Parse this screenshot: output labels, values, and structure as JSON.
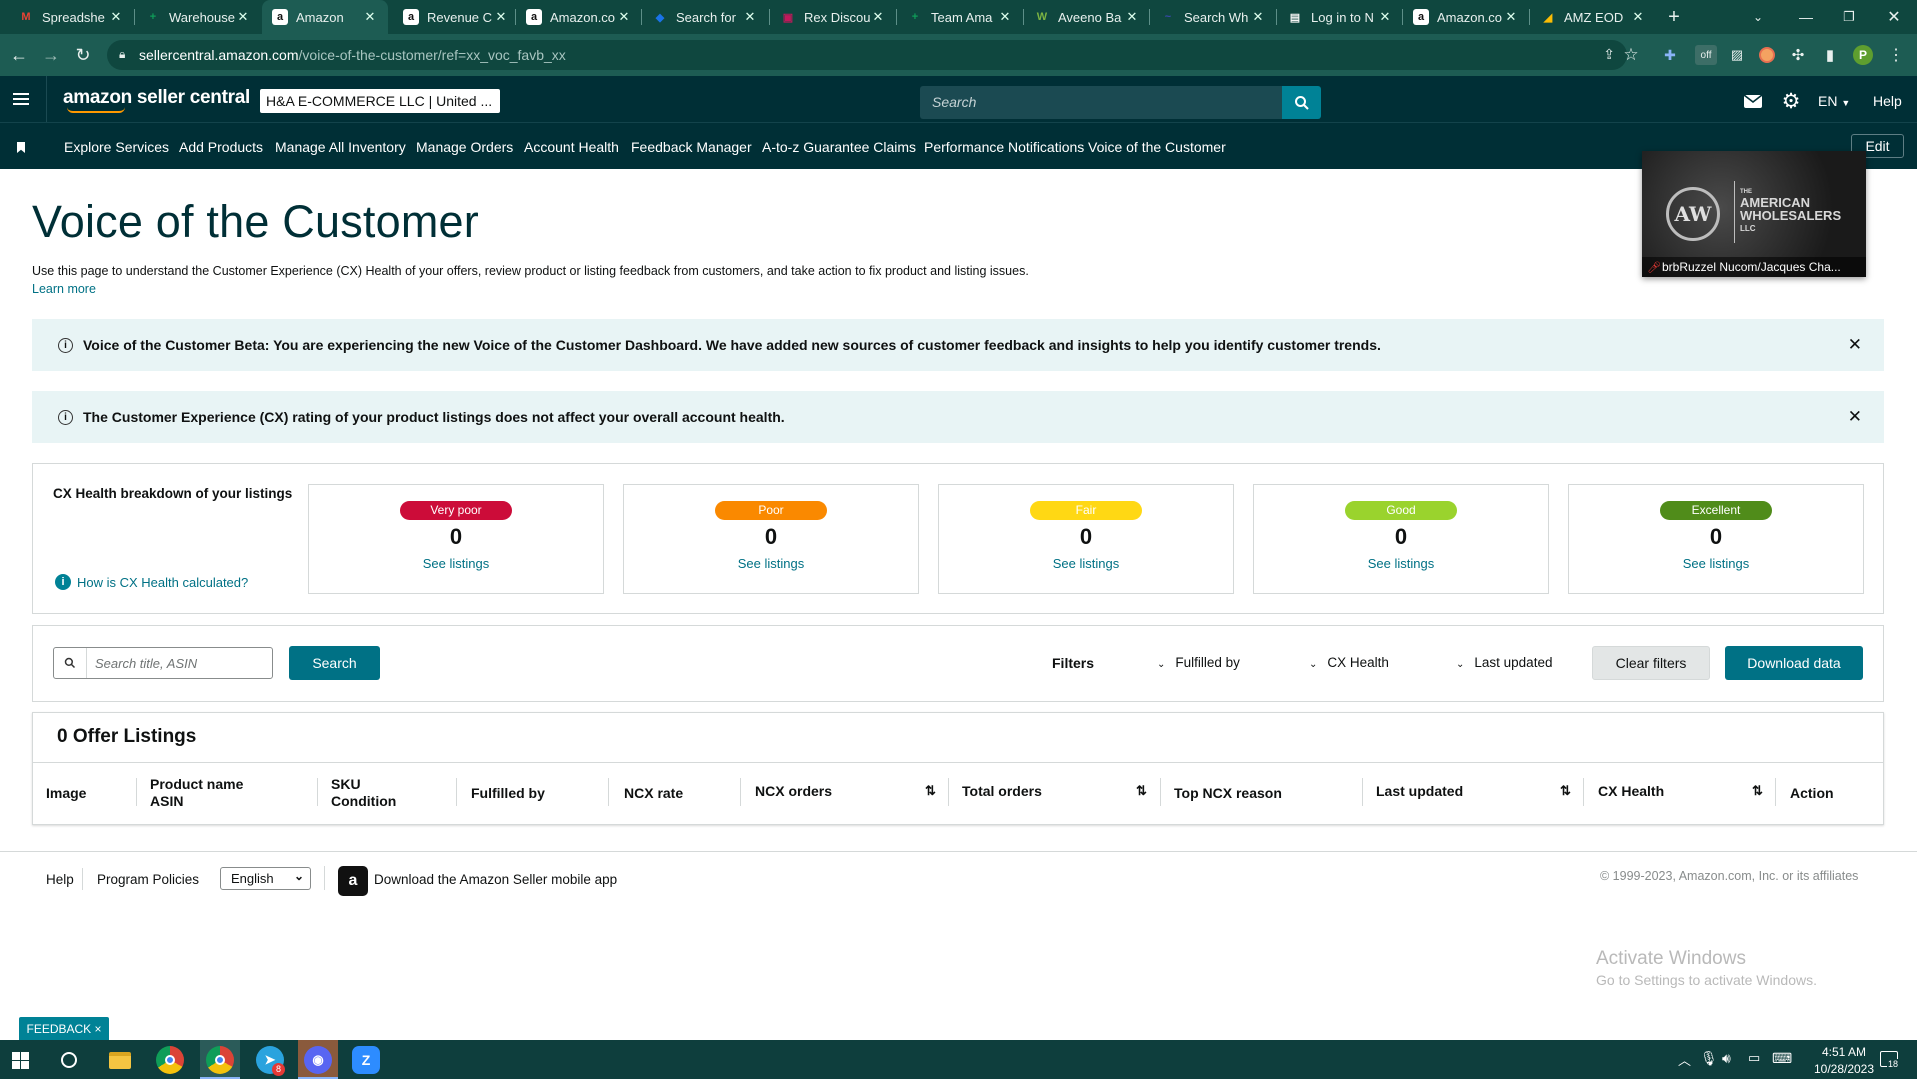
{
  "browser": {
    "tabs": [
      {
        "title": "Spreadshe",
        "fav": "M",
        "fav_color": "#ea4335"
      },
      {
        "title": "Warehouse",
        "fav": "+",
        "fav_color": "#0f9d58"
      },
      {
        "title": "Amazon",
        "fav": "a",
        "fav_color": "#111111"
      },
      {
        "title": "Revenue C",
        "fav": "a",
        "fav_color": "#111111"
      },
      {
        "title": "Amazon.co",
        "fav": "a",
        "fav_color": "#111111"
      },
      {
        "title": "Search for",
        "fav": "◆",
        "fav_color": "#1a73e8"
      },
      {
        "title": "Rex Discou",
        "fav": "▣",
        "fav_color": "#c2185b"
      },
      {
        "title": "Team Ama",
        "fav": "+",
        "fav_color": "#0f9d58"
      },
      {
        "title": "Aveeno Ba",
        "fav": "W",
        "fav_color": "#7cb342"
      },
      {
        "title": "Search Wh",
        "fav": "~",
        "fav_color": "#3949ab"
      },
      {
        "title": "Log in to N",
        "fav": "▤",
        "fav_color": "#f5f5f5"
      },
      {
        "title": "Amazon.co",
        "fav": "a",
        "fav_color": "#111111"
      },
      {
        "title": "AMZ EOD",
        "fav": "◢",
        "fav_color": "#fbbc04"
      }
    ],
    "url_host": "sellercentral.amazon.com",
    "url_path": "/voice-of-the-customer/ref=xx_voc_favb_xx",
    "profile_initial": "P"
  },
  "header": {
    "logo_text": "amazon seller central",
    "account_selector": "H&A E-COMMERCE LLC | United ...",
    "search_placeholder": "Search",
    "language": "EN",
    "help": "Help"
  },
  "nav": {
    "items": [
      "Explore Services",
      "Add Products",
      "Manage All Inventory",
      "Manage Orders",
      "Account Health",
      "Feedback Manager",
      "A-to-z Guarantee Claims",
      "Performance Notifications",
      "Voice of the Customer"
    ],
    "edit": "Edit"
  },
  "video_overlay": {
    "brand_line1": "THE",
    "brand_line2": "AMERICAN",
    "brand_line3": "WHOLESALERS",
    "brand_line4": "LLC",
    "caption": "brbRuzzel Nucom/Jacques Cha..."
  },
  "page": {
    "title": "Voice of the Customer",
    "description": "Use this page to understand the Customer Experience (CX) Health of your offers, review product or listing feedback from customers, and take action to fix product and listing issues.",
    "learn_more": "Learn more",
    "banner1": "Voice of the Customer Beta: You are experiencing the new Voice of the Customer Dashboard. We have added new sources of customer feedback and insights to help you identify customer trends.",
    "banner2": "The Customer Experience (CX) rating of your product listings does not affect your overall account health.",
    "breakdown_title": "CX Health breakdown of your listings",
    "how_calculated": "How is CX Health calculated?",
    "health_cards": [
      {
        "label": "Very poor",
        "count": "0",
        "link": "See listings",
        "color": "#cc0c39",
        "text_color": "#ffffff"
      },
      {
        "label": "Poor",
        "count": "0",
        "link": "See listings",
        "color": "#fa8900",
        "text_color": "#ffffff"
      },
      {
        "label": "Fair",
        "count": "0",
        "link": "See listings",
        "color": "#ffd814",
        "text_color": "#ffffff"
      },
      {
        "label": "Good",
        "count": "0",
        "link": "See listings",
        "color": "#9ad32d",
        "text_color": "#ffffff"
      },
      {
        "label": "Excellent",
        "count": "0",
        "link": "See listings",
        "color": "#508c1a",
        "text_color": "#ffffff"
      }
    ],
    "search_placeholder": "Search title, ASIN",
    "search_button": "Search",
    "filters_label": "Filters",
    "filter_fulfilled": "Fulfilled by",
    "filter_health": "CX Health",
    "filter_updated": "Last updated",
    "clear_filters": "Clear filters",
    "download": "Download data",
    "listings_title": "0 Offer Listings",
    "columns": {
      "image": "Image",
      "product_name": "Product name",
      "asin": "ASIN",
      "sku": "SKU",
      "condition": "Condition",
      "fulfilled_by": "Fulfilled by",
      "ncx_rate": "NCX rate",
      "ncx_orders": "NCX orders",
      "total_orders": "Total orders",
      "top_reason": "Top NCX reason",
      "last_updated": "Last updated",
      "cx_health": "CX Health",
      "action": "Action"
    }
  },
  "footer": {
    "help": "Help",
    "policies": "Program Policies",
    "language": "English",
    "app": "Download the Amazon Seller mobile app",
    "copyright": "© 1999-2023, Amazon.com, Inc. or its affiliates"
  },
  "watermark": {
    "line1": "Activate Windows",
    "line2": "Go to Settings to activate Windows."
  },
  "feedback": "FEEDBACK ×",
  "taskbar": {
    "time": "4:51 AM",
    "date": "10/28/2023",
    "notification_count": "18",
    "telegram_badge": "8"
  }
}
